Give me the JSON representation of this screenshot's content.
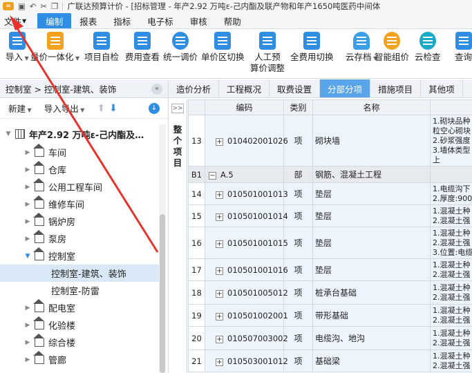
{
  "titlebar": {
    "text": "广联达预算计价 - [招标管理 - 年产2.92 万吨ε-己内酯及联产物和年产1650吨医药中间体"
  },
  "menu": {
    "items": [
      "文件",
      "编制",
      "报表",
      "指标",
      "电子标",
      "审核",
      "帮助"
    ]
  },
  "ribbon": {
    "buttons": [
      {
        "label": "导入",
        "icon": "import-icon"
      },
      {
        "label": "量价一体化",
        "icon": "integration-icon"
      },
      {
        "label": "项目自检",
        "icon": "self-check-icon"
      },
      {
        "label": "费用查看",
        "icon": "cost-view-icon"
      },
      {
        "label": "统一调价",
        "icon": "price-adjust-icon"
      },
      {
        "label": "单价区切换",
        "icon": "price-zone-icon"
      },
      {
        "label": "人工预\n算价调整",
        "icon": "labor-price-icon"
      },
      {
        "label": "全费用切换",
        "icon": "full-cost-icon"
      },
      {
        "label": "云存档",
        "icon": "cloud-save-icon"
      },
      {
        "label": "智能组价",
        "icon": "smart-pricing-icon"
      },
      {
        "label": "云检查",
        "icon": "cloud-check-icon"
      },
      {
        "label": "查询",
        "icon": "query-icon"
      }
    ]
  },
  "left_panel": {
    "breadcrumb": "控制室 > 控制室-建筑、装饰",
    "toolbar": {
      "new": "新建",
      "import_export": "导入导出"
    },
    "tree": [
      {
        "label": "年产2.92 万吨ε-己内酯及…",
        "level": 0
      },
      {
        "label": "车间",
        "level": 1
      },
      {
        "label": "仓库",
        "level": 1
      },
      {
        "label": "公用工程车间",
        "level": 1
      },
      {
        "label": "维修车间",
        "level": 1
      },
      {
        "label": "锅炉房",
        "level": 1
      },
      {
        "label": "泵房",
        "level": 1
      },
      {
        "label": "控制室",
        "level": 1
      },
      {
        "label": "控制室-建筑、装饰",
        "level": 2
      },
      {
        "label": "控制室-防雷",
        "level": 2
      },
      {
        "label": "配电室",
        "level": 1
      },
      {
        "label": "化验楼",
        "level": 1
      },
      {
        "label": "综合楼",
        "level": 1
      },
      {
        "label": "管廊",
        "level": 1
      }
    ]
  },
  "tabs": [
    "造价分析",
    "工程概况",
    "取费设置",
    "分部分项",
    "措施项目",
    "其他项"
  ],
  "side_strip": {
    "label": "整个项目"
  },
  "grid": {
    "headers": [
      "编码",
      "类别",
      "名称"
    ],
    "rows": [
      {
        "num": "13",
        "code": "010402001026",
        "cat": "项",
        "name": "砌块墙",
        "features": "1.砌块品种\n粒空心砌块\n2.砂浆强度\n3.墙体类型\n上"
      },
      {
        "num": "B1",
        "code": "A.5",
        "cat": "部",
        "name": "钢筋、混凝土工程",
        "features": ""
      },
      {
        "num": "14",
        "code": "010501001013",
        "cat": "项",
        "name": "垫层",
        "features": "1.电缆沟下\n2.厚度:900"
      },
      {
        "num": "15",
        "code": "010501001014",
        "cat": "项",
        "name": "垫层",
        "features": "1.混凝土种\n2.混凝土强"
      },
      {
        "num": "16",
        "code": "010501001015",
        "cat": "项",
        "name": "垫层",
        "features": "1.混凝土种\n2.混凝土强\n3.位置:电缆"
      },
      {
        "num": "17",
        "code": "010501001016",
        "cat": "项",
        "name": "垫层",
        "features": "1.混凝土种\n2.混凝土强"
      },
      {
        "num": "18",
        "code": "010501005012",
        "cat": "项",
        "name": "桩承台基础",
        "features": "1.混凝土种\n2.混凝土强"
      },
      {
        "num": "19",
        "code": "010501002001",
        "cat": "项",
        "name": "带形基础",
        "features": "1.混凝土种\n2.混凝土强"
      },
      {
        "num": "20",
        "code": "010507003002",
        "cat": "项",
        "name": "电缆沟、地沟",
        "features": "1.混凝土种\n2.混凝土强"
      },
      {
        "num": "21",
        "code": "010503001012",
        "cat": "项",
        "name": "基础梁",
        "features": "1.混凝土种\n2.混凝土强"
      }
    ]
  },
  "colors": {
    "accent": "#2f8de4",
    "annotation_arrow": "#e8332a"
  }
}
